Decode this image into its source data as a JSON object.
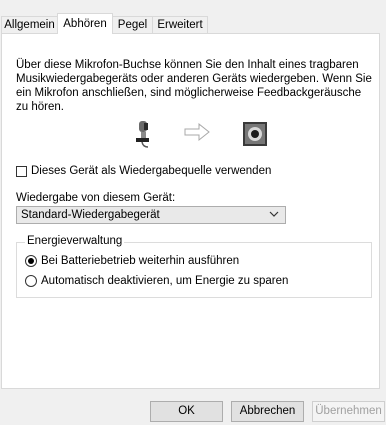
{
  "tabs": [
    {
      "label": "Allgemein",
      "active": false
    },
    {
      "label": "Abhören",
      "active": true
    },
    {
      "label": "Pegel",
      "active": false
    },
    {
      "label": "Erweitert",
      "active": false
    }
  ],
  "listen": {
    "description": "Über diese Mikrofon-Buchse können Sie den Inhalt eines tragbaren Musikwiedergabegeräts oder anderen Geräts wiedergeben. Wenn Sie ein Mikrofon anschließen, sind möglicherweise Feedbackgeräusche zu hören.",
    "illustration": [
      "microphone-icon",
      "arrow-right-icon",
      "speaker-icon"
    ],
    "checkbox_label": "Dieses Gerät als Wiedergabequelle verwenden",
    "checkbox_checked": false,
    "playback_label": "Wiedergabe von diesem Gerät:",
    "playback_value": "Standard-Wiedergabegerät"
  },
  "power": {
    "legend": "Energieverwaltung",
    "options": [
      {
        "label": "Bei Batteriebetrieb weiterhin ausführen",
        "selected": true
      },
      {
        "label": "Automatisch deaktivieren, um Energie zu sparen",
        "selected": false
      }
    ]
  },
  "buttons": {
    "ok": "OK",
    "cancel": "Abbrechen",
    "apply": "Übernehmen"
  }
}
